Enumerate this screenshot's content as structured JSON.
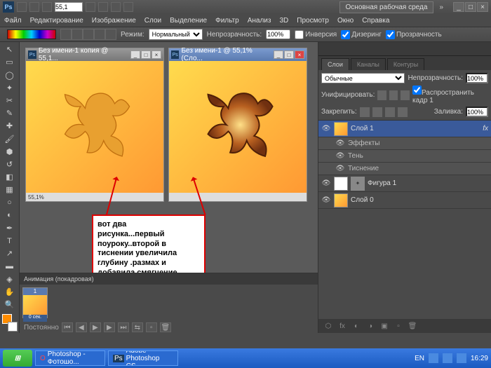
{
  "titlebar": {
    "zoom_value": "55,1",
    "workspace_label": "Основная рабочая среда"
  },
  "menu": [
    "Файл",
    "Редактирование",
    "Изображение",
    "Слои",
    "Выделение",
    "Фильтр",
    "Анализ",
    "3D",
    "Просмотр",
    "Окно",
    "Справка"
  ],
  "options": {
    "mode_label": "Режим:",
    "mode_value": "Нормальный",
    "opacity_label": "Непрозрачность:",
    "opacity_value": "100%",
    "invert": "Инверсия",
    "dither": "Дизеринг",
    "transparency": "Прозрачность"
  },
  "docs": {
    "d1": {
      "title": "Без имени-1 копия @ 55,1...",
      "zoom": "55,1%"
    },
    "d2": {
      "title": "Без имени-1 @ 55,1% (Сло...",
      "zoom": ""
    }
  },
  "annotation": "вот два\nрисунка...первый поуроку..второй в тиснении увеличила глубину .размах и добавила смягчение",
  "animation": {
    "title": "Анимация (покадровая)",
    "frame_num": "1",
    "duration": "0 сек.",
    "loop": "Постоянно"
  },
  "layers_panel": {
    "tabs": [
      "Слои",
      "Каналы",
      "Контуры"
    ],
    "blend": "Обычные",
    "opacity_label": "Непрозрачность:",
    "opacity": "100%",
    "unify": "Унифицировать:",
    "propagate": "Распространить кадр 1",
    "lock_label": "Закрепить:",
    "fill_label": "Заливка:",
    "fill": "100%",
    "layers": [
      {
        "name": "Слой 1",
        "fx": true
      },
      {
        "name": "Эффекты",
        "sub": true
      },
      {
        "name": "Тень",
        "sub": true
      },
      {
        "name": "Тиснение",
        "sub": true
      },
      {
        "name": "Фигура 1"
      },
      {
        "name": "Слой 0"
      }
    ]
  },
  "taskbar": {
    "tasks": [
      "Photoshop - Фотошо...",
      "Adobe Photoshop CS..."
    ],
    "lang": "EN",
    "time": "16:29"
  }
}
